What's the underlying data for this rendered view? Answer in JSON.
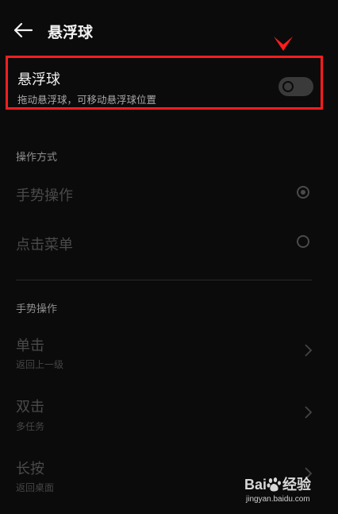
{
  "header": {
    "title": "悬浮球"
  },
  "floating_ball": {
    "title": "悬浮球",
    "subtitle": "拖动悬浮球，可移动悬浮球位置",
    "enabled": false
  },
  "operation_mode": {
    "section_label": "操作方式",
    "options": [
      {
        "label": "手势操作",
        "selected": true
      },
      {
        "label": "点击菜单",
        "selected": false
      }
    ]
  },
  "gestures": {
    "section_label": "手势操作",
    "items": [
      {
        "title": "单击",
        "subtitle": "返回上一级"
      },
      {
        "title": "双击",
        "subtitle": "多任务"
      },
      {
        "title": "长按",
        "subtitle": "返回桌面"
      }
    ]
  },
  "watermark": {
    "brand_left": "Bai",
    "brand_right": "经验",
    "url": "jingyan.baidu.com"
  },
  "colors": {
    "background": "#0b0b0b",
    "highlight_border": "#ff1d1d",
    "disabled_text": "#4a4a4a"
  }
}
